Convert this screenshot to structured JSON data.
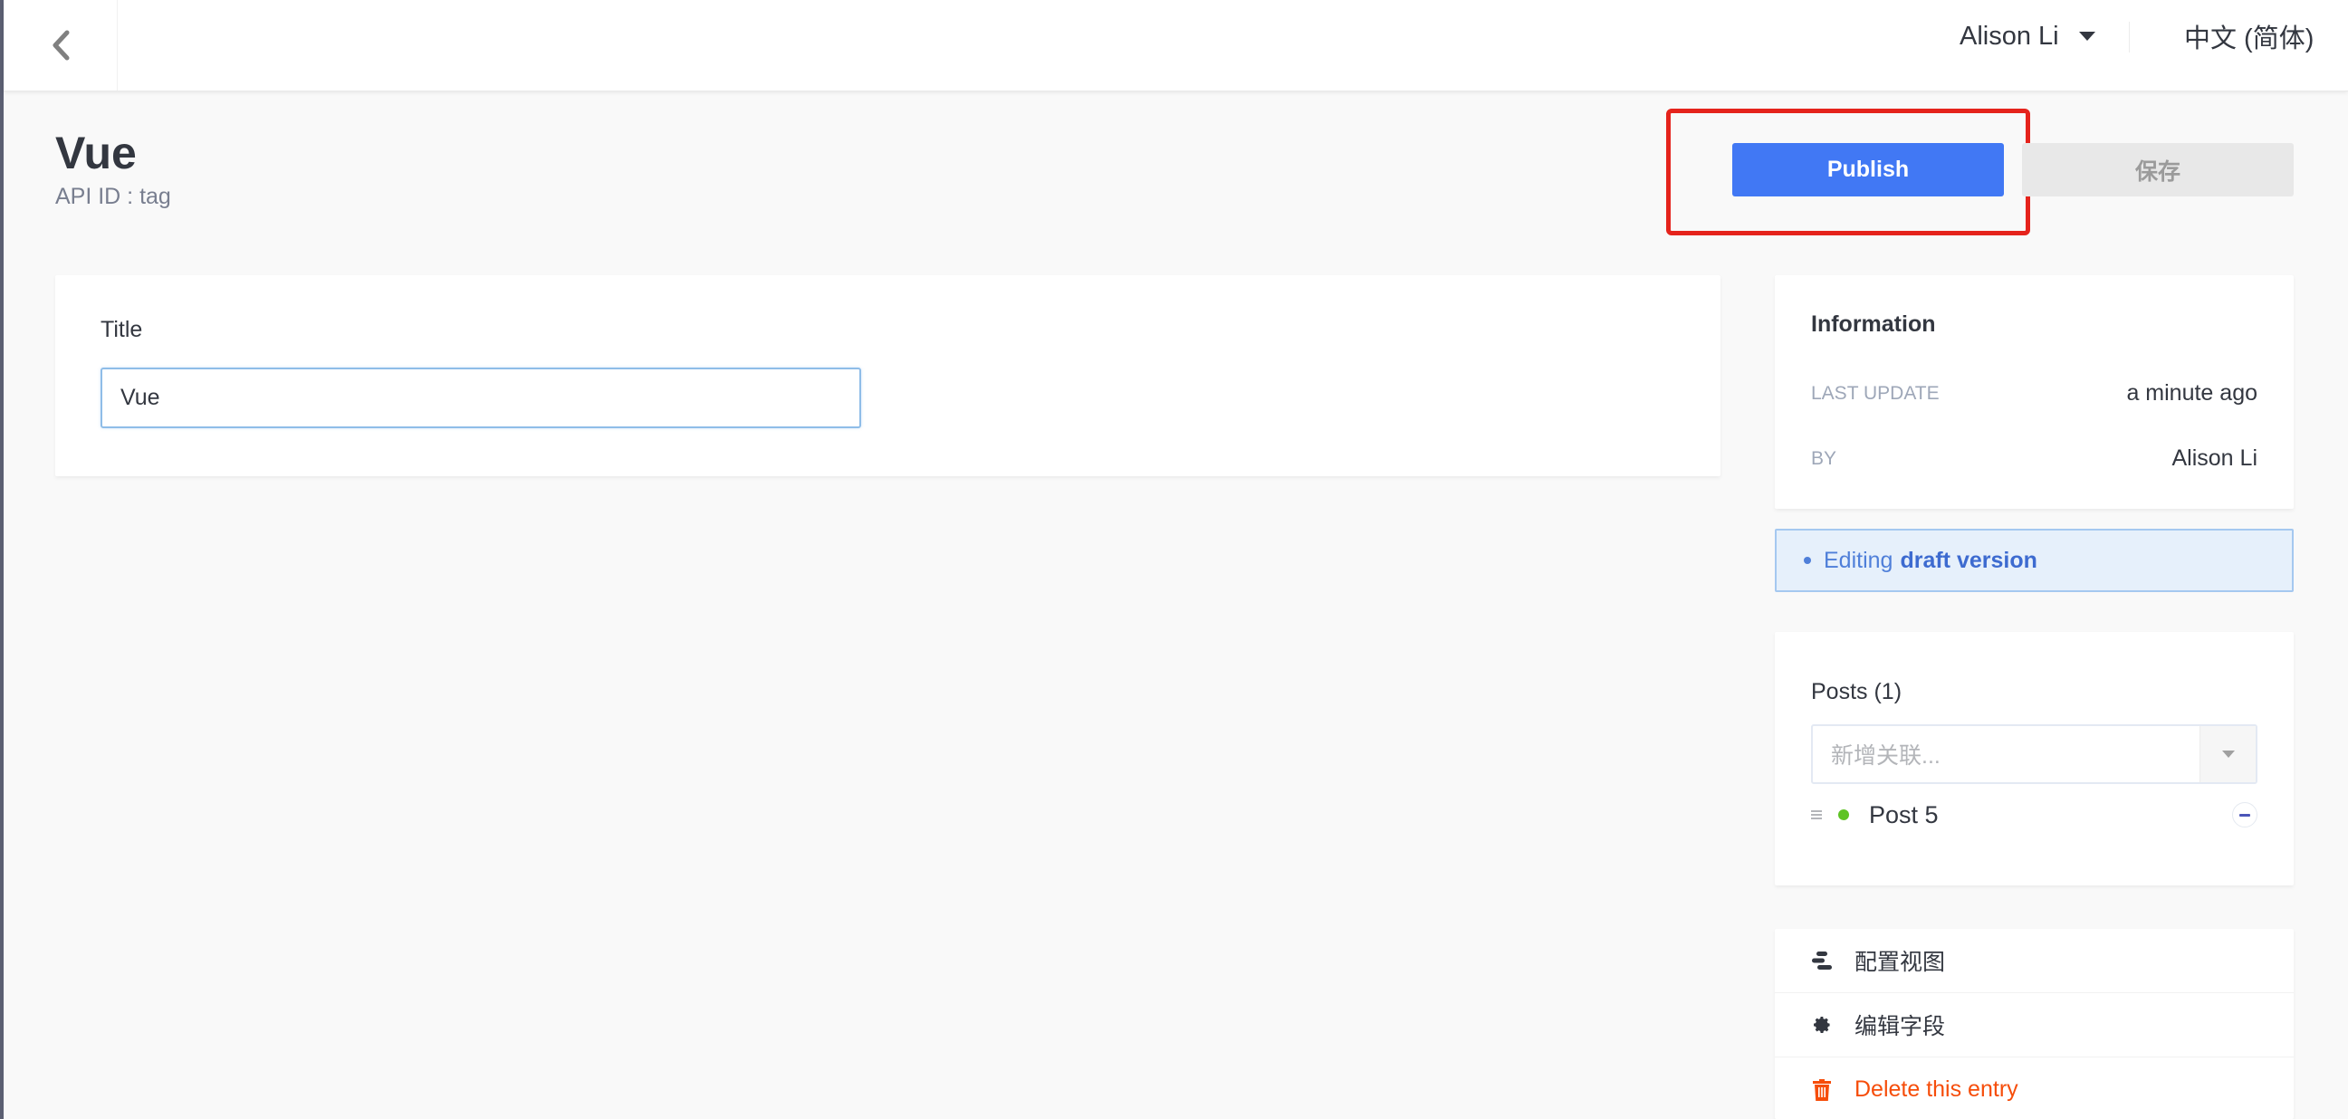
{
  "header": {
    "back_icon": "chevron-left-icon",
    "user_name": "Alison Li",
    "user_menu_icon": "caret-down-icon",
    "language": "中文 (简体)"
  },
  "page": {
    "title": "Vue",
    "subtitle": "API ID : tag"
  },
  "toolbar": {
    "publish_label": "Publish",
    "save_label": "保存"
  },
  "form": {
    "fields": [
      {
        "label": "Title",
        "value": "Vue"
      }
    ]
  },
  "information": {
    "heading": "Information",
    "rows": [
      {
        "key": "LAST UPDATE",
        "value": "a minute ago"
      },
      {
        "key": "BY",
        "value": "Alison Li"
      }
    ]
  },
  "draft_banner": {
    "prefix": "Editing",
    "emphasis": "draft version"
  },
  "relations": {
    "heading": "Posts (1)",
    "select_placeholder": "新增关联...",
    "items": [
      {
        "name": "Post 5",
        "status": "published"
      }
    ]
  },
  "actions": [
    {
      "label": "配置视图",
      "icon": "layout-icon"
    },
    {
      "label": "编辑字段",
      "icon": "gear-icon"
    },
    {
      "label": "Delete this entry",
      "icon": "trash-icon"
    }
  ],
  "colors": {
    "primary": "#4178f4",
    "danger": "#f64d0a",
    "highlight": "#e5231c",
    "status_published": "#5ec324"
  }
}
